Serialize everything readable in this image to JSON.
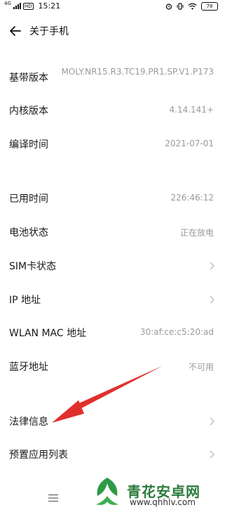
{
  "status_bar": {
    "signal_type": "4G",
    "hd_badge": "HD",
    "time": "15:21",
    "battery": "78"
  },
  "header": {
    "title": "关于手机"
  },
  "rows": [
    {
      "label": "基带版本",
      "value": "MOLY.NR15.R3.TC19.PR1.SP.V1.P173"
    },
    {
      "label": "内核版本",
      "value": "4.14.141+"
    },
    {
      "label": "编译时间",
      "value": "2021-07-01"
    },
    {
      "label": "已用时间",
      "value": "226:46:12"
    },
    {
      "label": "电池状态",
      "value": "正在放电"
    },
    {
      "label": "SIM卡状态",
      "value": ""
    },
    {
      "label": "IP 地址",
      "value": ""
    },
    {
      "label": "WLAN MAC 地址",
      "value": "30:af:ce:c5:20:ad"
    },
    {
      "label": "蓝牙地址",
      "value": "不可用"
    },
    {
      "label": "法律信息",
      "value": ""
    },
    {
      "label": "预置应用列表",
      "value": ""
    }
  ],
  "watermark": {
    "name": "青花安卓网",
    "url": "www.qhhlv.com"
  }
}
